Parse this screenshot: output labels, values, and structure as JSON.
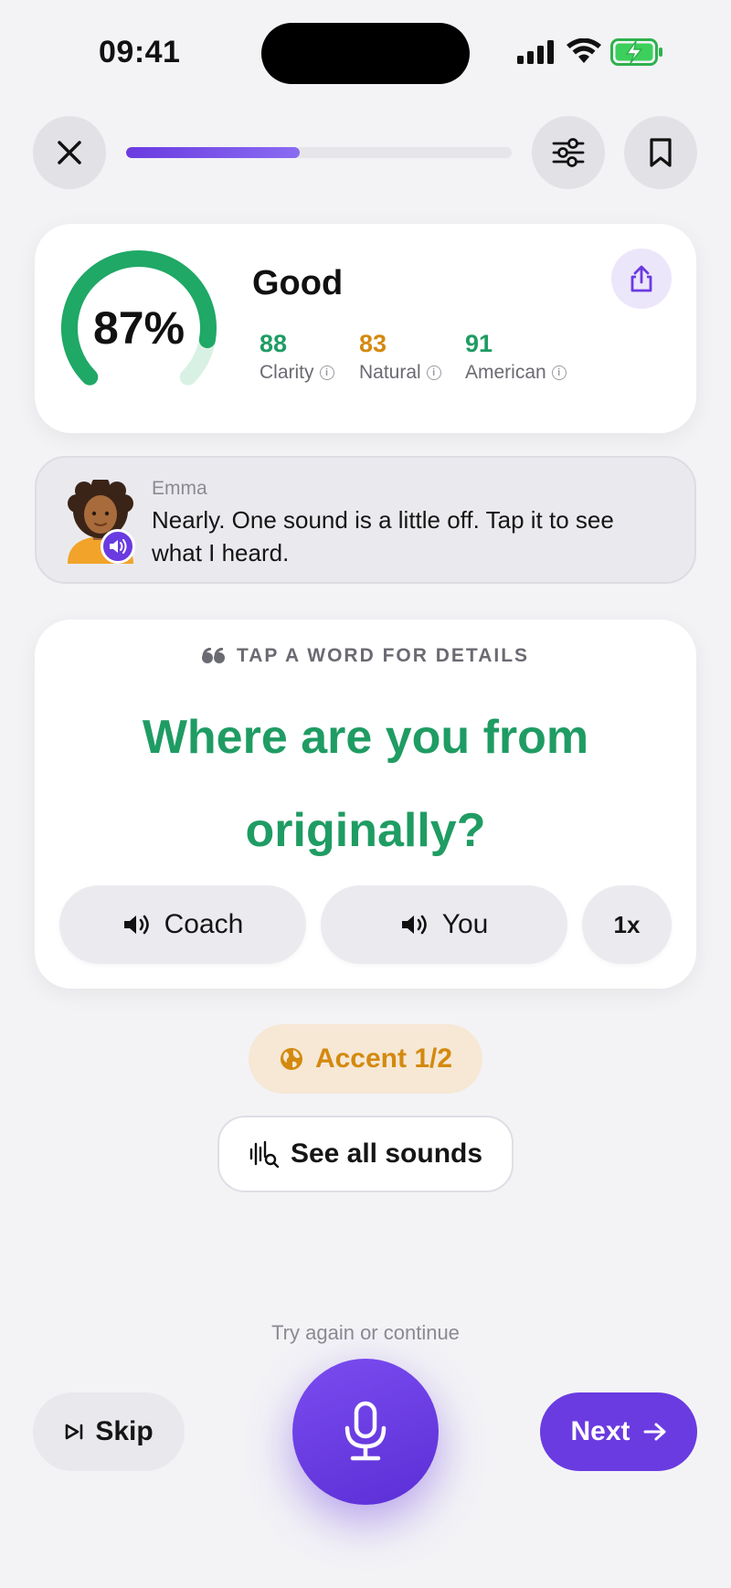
{
  "status_bar": {
    "time": "09:41"
  },
  "top_bar": {
    "progress": 0.45,
    "progress_color": "#6a3be0"
  },
  "score_card": {
    "overall_percent_text": "87%",
    "overall_value": 0.87,
    "rating": "Good",
    "metrics": [
      {
        "value": "88",
        "label": "Clarity",
        "color": "#1f9c63"
      },
      {
        "value": "83",
        "label": "Natural",
        "color": "#d4890f"
      },
      {
        "value": "91",
        "label": "American",
        "color": "#1f9c63"
      }
    ],
    "gauge_color": "#1fa866"
  },
  "coach": {
    "name": "Emma",
    "message": "Nearly. One sound is a little off. Tap it to see what I heard."
  },
  "phrase_card": {
    "hint": "TAP A WORD FOR DETAILS",
    "phrase": "Where are you from originally?",
    "phrase_color": "#1f9c63",
    "coach_button": "Coach",
    "you_button": "You",
    "speed_button": "1x"
  },
  "accent_badge": {
    "label": "Accent 1/2",
    "color": "#d4890f"
  },
  "see_sounds_button": "See all sounds",
  "hint_text": "Try again or continue",
  "bottom": {
    "skip_label": "Skip",
    "next_label": "Next",
    "accent_color": "#6a3be0"
  }
}
